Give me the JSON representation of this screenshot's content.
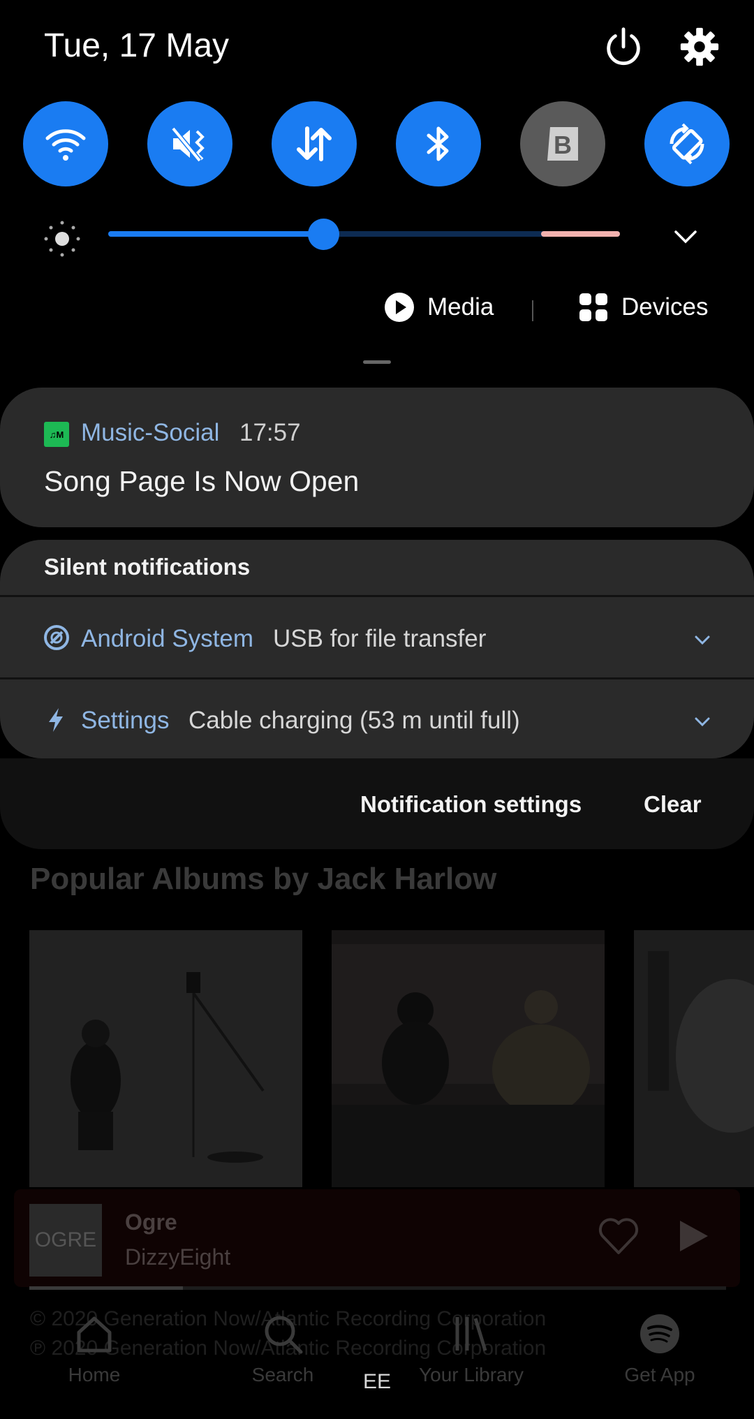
{
  "status": {
    "date": "Tue, 17 May"
  },
  "quick_settings": {
    "tiles": [
      {
        "name": "wifi",
        "icon": "wifi-icon",
        "active": true
      },
      {
        "name": "sound",
        "icon": "vibrate-icon",
        "active": true
      },
      {
        "name": "mobile-data",
        "icon": "data-arrows-icon",
        "active": true
      },
      {
        "name": "bluetooth",
        "icon": "bluetooth-icon",
        "active": true
      },
      {
        "name": "bixby-routines",
        "icon": "b-icon",
        "active": false
      },
      {
        "name": "auto-rotate",
        "icon": "rotate-icon",
        "active": true
      }
    ],
    "brightness_level": 0.42,
    "accent_color": "#1a7cf2",
    "media_label": "Media",
    "devices_label": "Devices"
  },
  "notifications": {
    "main": {
      "app_badge": "♫M",
      "app_name": "Music-Social",
      "time": "17:57",
      "title": "Song Page Is Now Open"
    },
    "silent_header": "Silent notifications",
    "silent": [
      {
        "app": "Android System",
        "text": "USB for file transfer",
        "icon": "android-system-icon"
      },
      {
        "app": "Settings",
        "text": "Cable charging (53 m until full)",
        "icon": "bolt-icon"
      }
    ],
    "settings_label": "Notification settings",
    "clear_label": "Clear"
  },
  "background_app": {
    "section_title": "Popular Albums by Jack Harlow",
    "now_playing": {
      "art_text": "OGRE",
      "title": "Ogre",
      "artist": "DizzyEight",
      "progress": 0.22
    },
    "copyright_lines": [
      "© 2020 Generation Now/Atlantic Recording Corporation",
      "℗ 2020 Generation Now/Atlantic Recording Corporation"
    ],
    "nav": [
      {
        "label": "Home",
        "icon": "home-icon"
      },
      {
        "label": "Search",
        "icon": "search-icon"
      },
      {
        "label": "Your Library",
        "icon": "library-icon"
      },
      {
        "label": "Get App",
        "icon": "spotify-icon"
      }
    ]
  },
  "carrier": "EE"
}
